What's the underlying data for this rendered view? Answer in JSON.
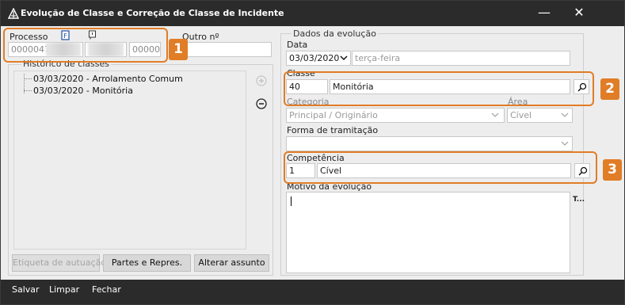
{
  "window": {
    "title": "Evolução de Classe e Correção de Classe de Incidente",
    "minimize_glyph": "—",
    "close_glyph": "✕"
  },
  "processo": {
    "label": "Processo",
    "number_start": "0000047-",
    "number_end": "00000",
    "outro_label": "Outro nº",
    "outro_value": ""
  },
  "historico": {
    "legend": "Histórico de classes",
    "items": [
      {
        "label": "03/03/2020 - Arrolamento Comum"
      },
      {
        "label": "03/03/2020 - Monitória"
      }
    ],
    "buttons": {
      "etiqueta": "Etiqueta de autuação",
      "partes": "Partes e Repres.",
      "alterar": "Alterar assunto"
    }
  },
  "evolucao": {
    "legend": "Dados da evolução",
    "data_label": "Data",
    "data_value": "03/03/2020",
    "weekday": "terça-feira",
    "classe_label": "Classe",
    "classe_code": "40",
    "classe_name": "Monitória",
    "categoria_label": "Categoria",
    "categoria_value": "Principal / Originário",
    "area_label": "Área",
    "area_value": "Cível",
    "forma_label": "Forma de tramitação",
    "forma_value": "",
    "competencia_label": "Competência",
    "competencia_code": "1",
    "competencia_name": "Cível",
    "motivo_label": "Motivo da evolução",
    "motivo_value": "",
    "spell_hint": "T..."
  },
  "annotations": [
    "1",
    "2",
    "3"
  ],
  "footer": {
    "salvar": "Salvar",
    "limpar": "Limpar",
    "fechar": "Fechar"
  },
  "colors": {
    "titlebar": "#2b2b2b",
    "annotation": "#e07d26",
    "window_bg": "#ededed"
  },
  "icons": [
    "app-logo-icon",
    "document-link-icon",
    "note-icon",
    "add-icon",
    "remove-icon",
    "chevron-down-icon",
    "search-icon"
  ]
}
